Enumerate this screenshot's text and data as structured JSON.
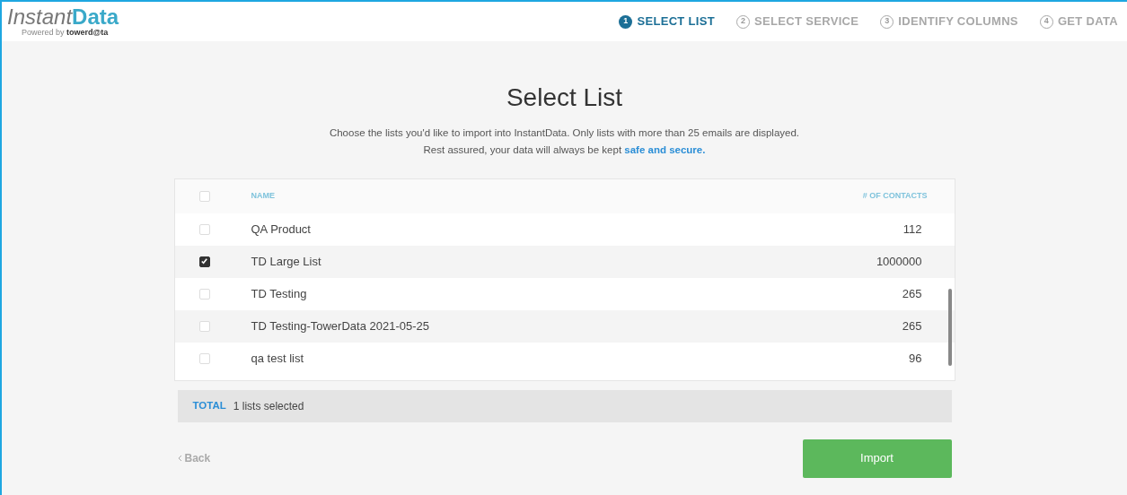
{
  "logo": {
    "name_light": "Instant",
    "name_bold": "Data",
    "powered_by": "Powered by",
    "brand": "towerd@ta"
  },
  "steps": [
    {
      "number": "1",
      "label": "SELECT LIST",
      "selected": true
    },
    {
      "number": "2",
      "label": "SELECT SERVICE",
      "selected": false
    },
    {
      "number": "3",
      "label": "IDENTIFY COLUMNS",
      "selected": false
    },
    {
      "number": "4",
      "label": "GET DATA",
      "selected": false
    }
  ],
  "title": "Select List",
  "description": "Choose the lists you'd like to import into InstantData. Only lists with more than 25 emails are displayed.",
  "assurance": "Rest assured, your data will always be kept",
  "assurance_link": "safe and secure.",
  "table": {
    "select_all_checked": false,
    "columns": [
      "NAME",
      "# OF CONTACTS"
    ],
    "rows": [
      {
        "name": "QA Product",
        "contacts": "112",
        "checked": false
      },
      {
        "name": "TD Large List",
        "contacts": "1000000",
        "checked": true
      },
      {
        "name": "TD Testing",
        "contacts": "265",
        "checked": false
      },
      {
        "name": "TD Testing-TowerData 2021-05-25",
        "contacts": "265",
        "checked": false
      },
      {
        "name": "qa test list",
        "contacts": "96",
        "checked": false
      }
    ]
  },
  "total": {
    "label": "TOTAL",
    "value": "1 lists selected"
  },
  "back": "Back",
  "import": "Import"
}
